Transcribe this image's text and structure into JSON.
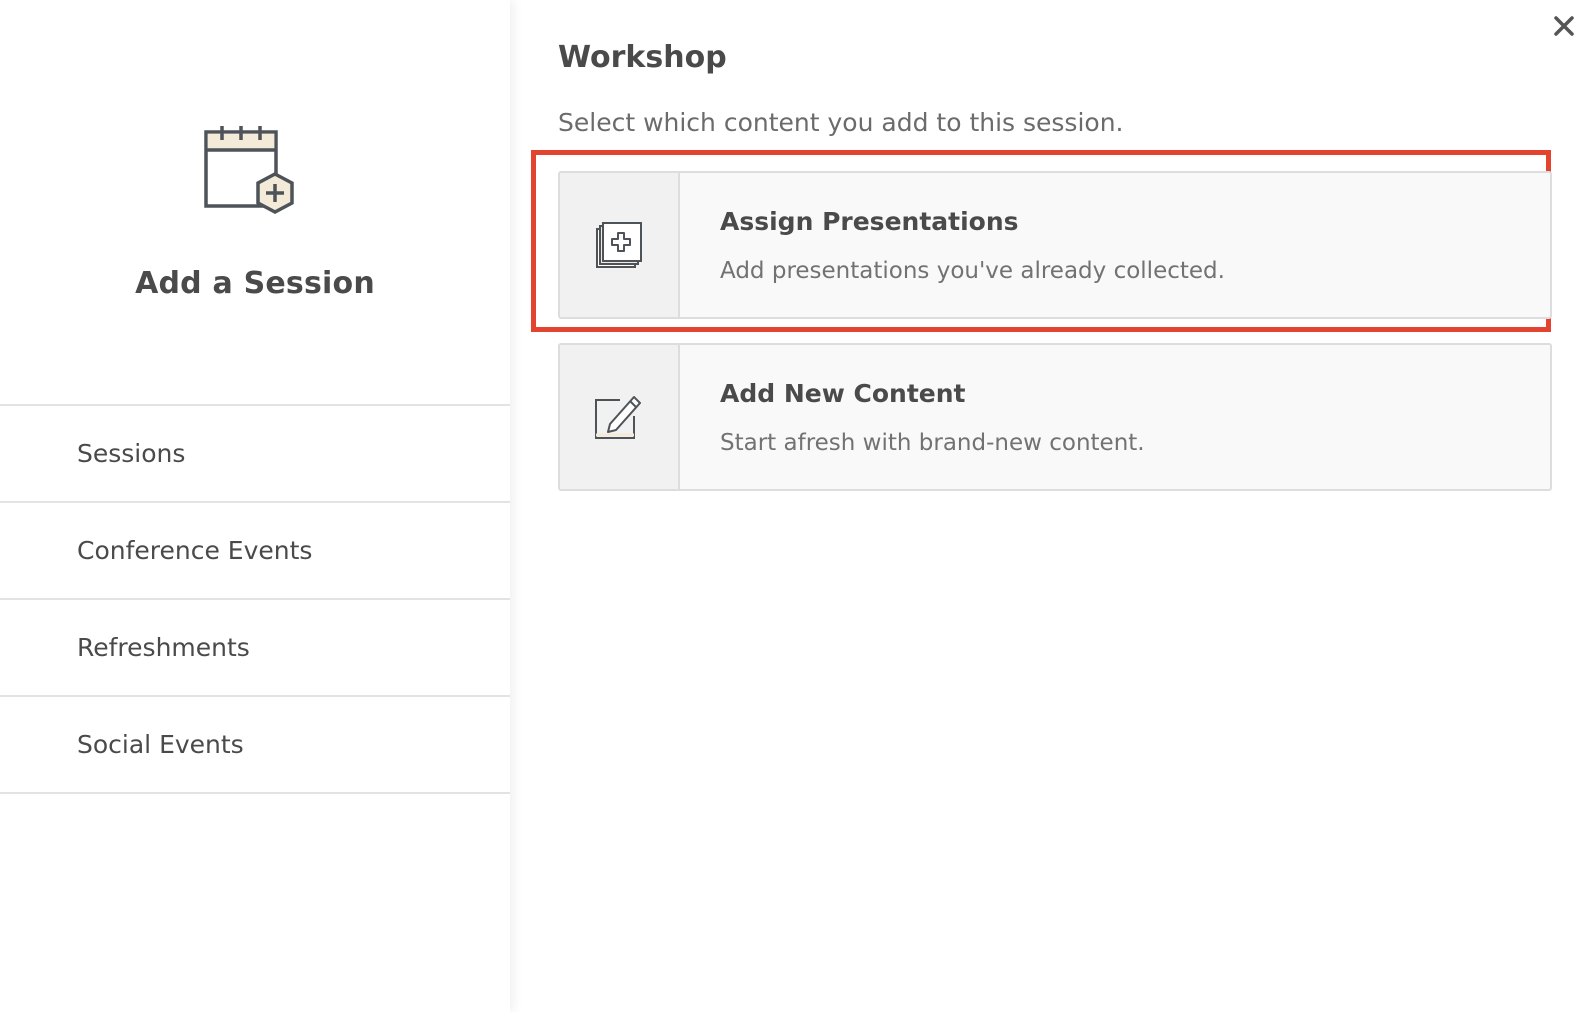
{
  "sidebar": {
    "title": "Add a Session",
    "icon": "calendar-add-icon",
    "items": [
      {
        "label": "Sessions"
      },
      {
        "label": "Conference Events"
      },
      {
        "label": "Refreshments"
      },
      {
        "label": "Social Events"
      }
    ]
  },
  "panel": {
    "title": "Workshop",
    "subtitle": "Select which content you add to this session.",
    "close_icon": "close-icon",
    "options": [
      {
        "title": "Assign Presentations",
        "description": "Add presentations you've already collected.",
        "icon": "duplicate-add-icon",
        "highlighted": true
      },
      {
        "title": "Add New Content",
        "description": "Start afresh with brand-new content.",
        "icon": "edit-icon",
        "highlighted": false
      }
    ]
  },
  "colors": {
    "highlight": "#e2442f",
    "text": "#4a4a4a",
    "calendar_accent": "#f3ead8"
  }
}
